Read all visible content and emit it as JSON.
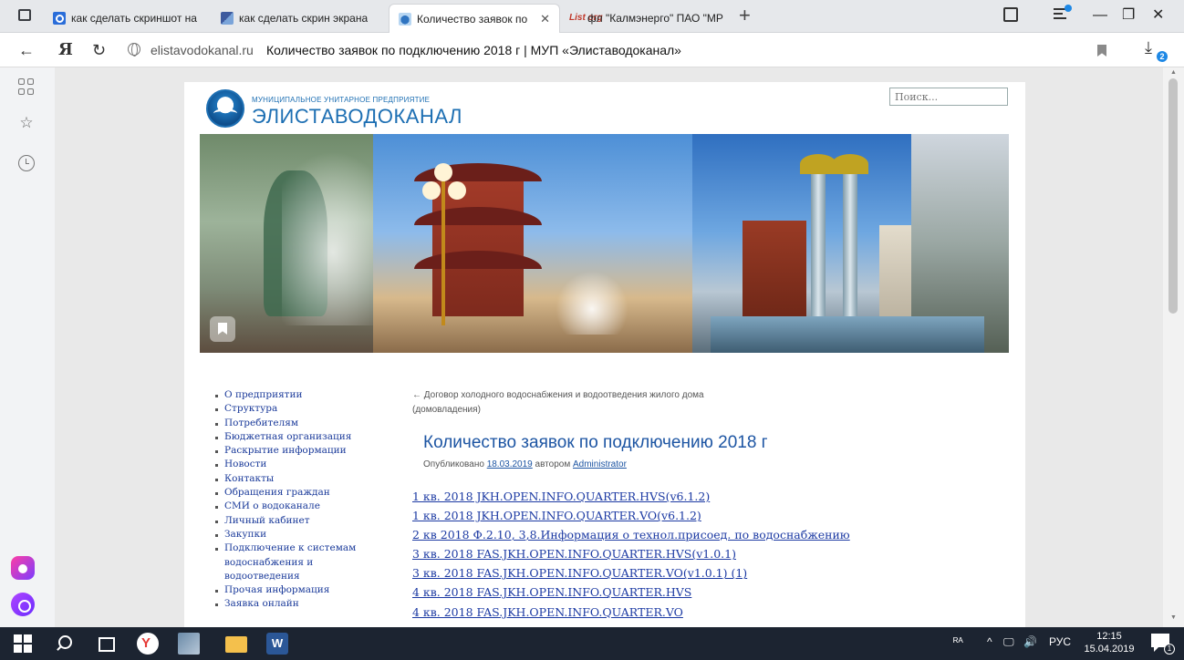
{
  "browser": {
    "tabs": [
      {
        "title": "как сделать скриншот на к",
        "favicon": "search-icon"
      },
      {
        "title": "как сделать скрин экрана",
        "favicon": "image-icon"
      },
      {
        "title": "Количество заявок по п",
        "favicon": "vodokanal-icon",
        "active": true
      },
      {
        "title": "фл \"Калмэнерго\" ПАО \"МР",
        "favicon": "list-org-icon"
      }
    ],
    "list_fav_text": "List org",
    "new_tab": "+",
    "address": {
      "domain": "elistavodokanal.ru",
      "page_title": "Количество заявок по подключению 2018 г | МУП «Элиставодоканал»"
    },
    "back": "←",
    "yandex_logo": "Я",
    "reload": "↻",
    "download_icon": "⤓",
    "downloads_badge": "2",
    "window_controls": {
      "minimize": "—",
      "maximize": "❐",
      "close": "✕"
    },
    "tab_close": "✕",
    "sidebar_star": "☆"
  },
  "site": {
    "logo_small": "МУНИЦИПАЛЬНОЕ УНИТАРНОЕ ПРЕДПРИЯТИЕ",
    "logo_big": "ЭЛИСТАВОДОКАНАЛ",
    "search_placeholder": "Поиск...",
    "menu": [
      "О предприятии",
      "Структура",
      "Потребителям",
      "Бюджетная организация",
      "Раскрытие информации",
      "Новости",
      "Контакты",
      "Обращения граждан",
      "СМИ о водоканале",
      "Личный кабинет",
      "Закупки",
      "Подключение к системам",
      "Прочая информация",
      "Заявка онлайн"
    ],
    "menu_wrap": [
      "водоснабжения и",
      "водоотведения"
    ],
    "prev_post": "← Договор холодного водоснабжения и водоотведения жилого дома (домовладения)",
    "post_title": "Количество заявок по подключению 2018 г",
    "meta": {
      "published": "Опубликовано",
      "date": "18.03.2019",
      "by": "автором",
      "author": "Administrator"
    },
    "documents": [
      "1 кв. 2018 JKH.OPEN.INFO.QUARTER.HVS(v6.1.2)",
      "1 кв. 2018 JKH.OPEN.INFO.QUARTER.VO(v6.1.2)",
      "2 кв 2018 Ф.2.10, 3,8.Информация о технол.присоед. по водоснабжению",
      "3 кв. 2018 FAS.JKH.OPEN.INFO.QUARTER.HVS(v1.0.1)",
      "3 кв. 2018 FAS.JKH.OPEN.INFO.QUARTER.VO(v1.0.1) (1)",
      "4 кв. 2018 FAS.JKH.OPEN.INFO.QUARTER.HVS",
      "4 кв. 2018 FAS.JKH.OPEN.INFO.QUARTER.VO"
    ]
  },
  "taskbar": {
    "word_label": "W",
    "tray_person": "ᴿᴬ",
    "tray_arrow": "^",
    "tray_network": "🖵",
    "tray_volume": "🔊",
    "language": "РУС",
    "time": "12:15",
    "date": "15.04.2019",
    "notifications_count": "1"
  },
  "colors": {
    "link": "#1c3aa3",
    "title_blue": "#1d55a3",
    "taskbar": "#1c2431",
    "download_badge": "#1e88e5"
  }
}
